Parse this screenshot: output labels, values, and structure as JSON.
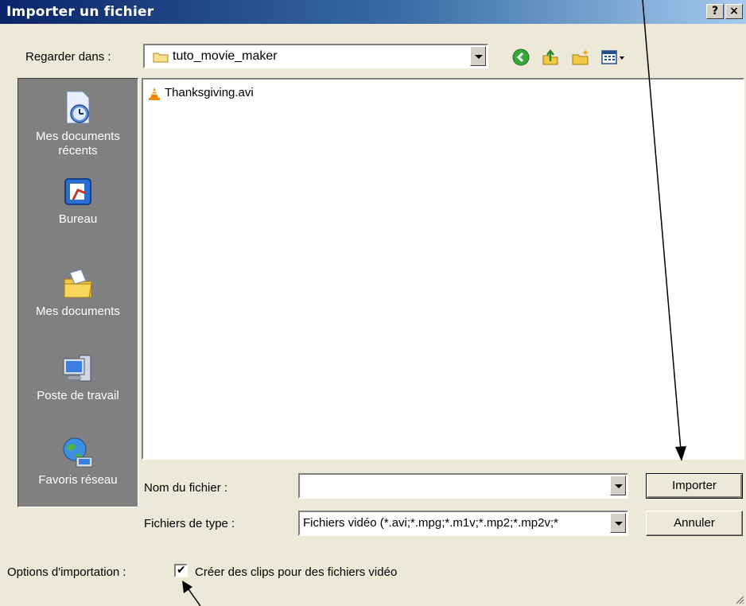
{
  "window": {
    "title": "Importer un fichier",
    "help_glyph": "?",
    "close_glyph": "×"
  },
  "lookin": {
    "label": "Regarder dans :",
    "value": "tuto_movie_maker"
  },
  "toolbar": {
    "icons": [
      "back-icon",
      "up-folder-icon",
      "new-folder-icon",
      "view-menu-icon"
    ]
  },
  "places": [
    {
      "label": "Mes documents récents",
      "icon": "recent-documents-icon"
    },
    {
      "label": "Bureau",
      "icon": "desktop-icon"
    },
    {
      "label": "Mes documents",
      "icon": "my-documents-icon"
    },
    {
      "label": "Poste de travail",
      "icon": "my-computer-icon"
    },
    {
      "label": "Favoris réseau",
      "icon": "network-places-icon"
    }
  ],
  "files": [
    {
      "name": "Thanksgiving.avi",
      "icon": "vlc-cone-icon"
    }
  ],
  "filename": {
    "label": "Nom du fichier :",
    "value": ""
  },
  "filetype": {
    "label": "Fichiers de type :",
    "value": "Fichiers vidéo (*.avi;*.mpg;*.m1v;*.mp2;*.mp2v;*"
  },
  "buttons": {
    "import": "Importer",
    "cancel": "Annuler"
  },
  "options": {
    "label": "Options d'importation :",
    "checkbox_label": "Créer des clips pour des fichiers vidéo",
    "checked": true
  }
}
